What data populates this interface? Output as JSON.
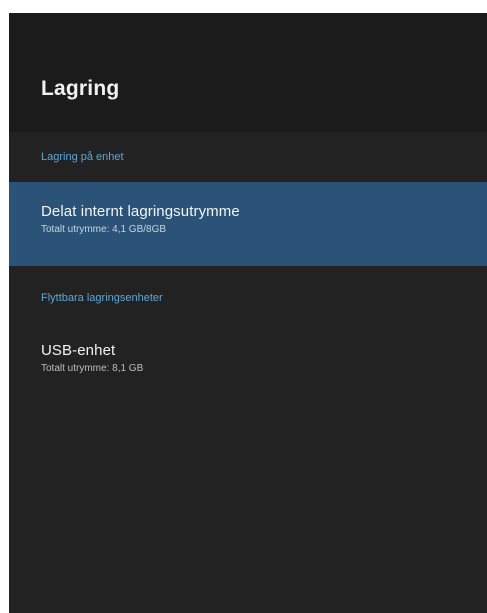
{
  "colors": {
    "background": "#1d1d1d",
    "panel": "#222222",
    "accent": "#5ea7d6",
    "selected_row": "#2a5377"
  },
  "header": {
    "title": "Lagring"
  },
  "sections": [
    {
      "label": "Lagring på enhet",
      "items": [
        {
          "title": "Delat internt lagringsutrymme",
          "subtitle": "Totalt utrymme: 4,1 GB/8GB",
          "selected": true
        }
      ]
    },
    {
      "label": "Flyttbara lagringsenheter",
      "items": [
        {
          "title": "USB-enhet",
          "subtitle": "Totalt utrymme: 8,1 GB",
          "selected": false
        }
      ]
    }
  ]
}
